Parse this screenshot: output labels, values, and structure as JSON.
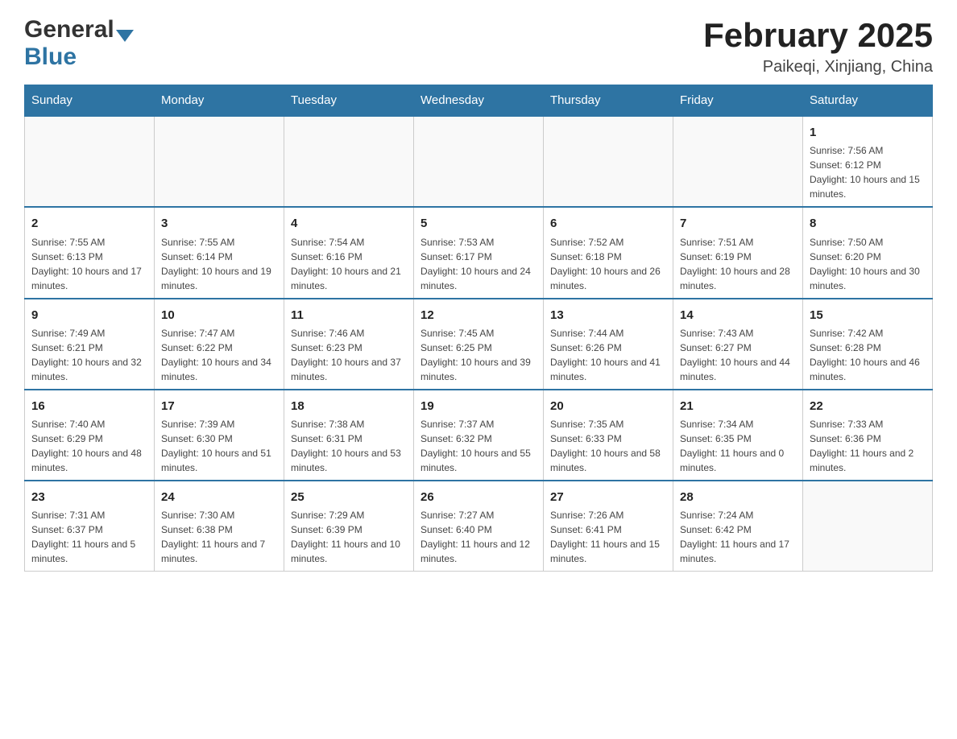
{
  "header": {
    "logo_general": "General",
    "logo_blue": "Blue",
    "month_title": "February 2025",
    "location": "Paikeqi, Xinjiang, China"
  },
  "weekdays": [
    "Sunday",
    "Monday",
    "Tuesday",
    "Wednesday",
    "Thursday",
    "Friday",
    "Saturday"
  ],
  "weeks": [
    [
      {
        "day": "",
        "info": ""
      },
      {
        "day": "",
        "info": ""
      },
      {
        "day": "",
        "info": ""
      },
      {
        "day": "",
        "info": ""
      },
      {
        "day": "",
        "info": ""
      },
      {
        "day": "",
        "info": ""
      },
      {
        "day": "1",
        "info": "Sunrise: 7:56 AM\nSunset: 6:12 PM\nDaylight: 10 hours and 15 minutes."
      }
    ],
    [
      {
        "day": "2",
        "info": "Sunrise: 7:55 AM\nSunset: 6:13 PM\nDaylight: 10 hours and 17 minutes."
      },
      {
        "day": "3",
        "info": "Sunrise: 7:55 AM\nSunset: 6:14 PM\nDaylight: 10 hours and 19 minutes."
      },
      {
        "day": "4",
        "info": "Sunrise: 7:54 AM\nSunset: 6:16 PM\nDaylight: 10 hours and 21 minutes."
      },
      {
        "day": "5",
        "info": "Sunrise: 7:53 AM\nSunset: 6:17 PM\nDaylight: 10 hours and 24 minutes."
      },
      {
        "day": "6",
        "info": "Sunrise: 7:52 AM\nSunset: 6:18 PM\nDaylight: 10 hours and 26 minutes."
      },
      {
        "day": "7",
        "info": "Sunrise: 7:51 AM\nSunset: 6:19 PM\nDaylight: 10 hours and 28 minutes."
      },
      {
        "day": "8",
        "info": "Sunrise: 7:50 AM\nSunset: 6:20 PM\nDaylight: 10 hours and 30 minutes."
      }
    ],
    [
      {
        "day": "9",
        "info": "Sunrise: 7:49 AM\nSunset: 6:21 PM\nDaylight: 10 hours and 32 minutes."
      },
      {
        "day": "10",
        "info": "Sunrise: 7:47 AM\nSunset: 6:22 PM\nDaylight: 10 hours and 34 minutes."
      },
      {
        "day": "11",
        "info": "Sunrise: 7:46 AM\nSunset: 6:23 PM\nDaylight: 10 hours and 37 minutes."
      },
      {
        "day": "12",
        "info": "Sunrise: 7:45 AM\nSunset: 6:25 PM\nDaylight: 10 hours and 39 minutes."
      },
      {
        "day": "13",
        "info": "Sunrise: 7:44 AM\nSunset: 6:26 PM\nDaylight: 10 hours and 41 minutes."
      },
      {
        "day": "14",
        "info": "Sunrise: 7:43 AM\nSunset: 6:27 PM\nDaylight: 10 hours and 44 minutes."
      },
      {
        "day": "15",
        "info": "Sunrise: 7:42 AM\nSunset: 6:28 PM\nDaylight: 10 hours and 46 minutes."
      }
    ],
    [
      {
        "day": "16",
        "info": "Sunrise: 7:40 AM\nSunset: 6:29 PM\nDaylight: 10 hours and 48 minutes."
      },
      {
        "day": "17",
        "info": "Sunrise: 7:39 AM\nSunset: 6:30 PM\nDaylight: 10 hours and 51 minutes."
      },
      {
        "day": "18",
        "info": "Sunrise: 7:38 AM\nSunset: 6:31 PM\nDaylight: 10 hours and 53 minutes."
      },
      {
        "day": "19",
        "info": "Sunrise: 7:37 AM\nSunset: 6:32 PM\nDaylight: 10 hours and 55 minutes."
      },
      {
        "day": "20",
        "info": "Sunrise: 7:35 AM\nSunset: 6:33 PM\nDaylight: 10 hours and 58 minutes."
      },
      {
        "day": "21",
        "info": "Sunrise: 7:34 AM\nSunset: 6:35 PM\nDaylight: 11 hours and 0 minutes."
      },
      {
        "day": "22",
        "info": "Sunrise: 7:33 AM\nSunset: 6:36 PM\nDaylight: 11 hours and 2 minutes."
      }
    ],
    [
      {
        "day": "23",
        "info": "Sunrise: 7:31 AM\nSunset: 6:37 PM\nDaylight: 11 hours and 5 minutes."
      },
      {
        "day": "24",
        "info": "Sunrise: 7:30 AM\nSunset: 6:38 PM\nDaylight: 11 hours and 7 minutes."
      },
      {
        "day": "25",
        "info": "Sunrise: 7:29 AM\nSunset: 6:39 PM\nDaylight: 11 hours and 10 minutes."
      },
      {
        "day": "26",
        "info": "Sunrise: 7:27 AM\nSunset: 6:40 PM\nDaylight: 11 hours and 12 minutes."
      },
      {
        "day": "27",
        "info": "Sunrise: 7:26 AM\nSunset: 6:41 PM\nDaylight: 11 hours and 15 minutes."
      },
      {
        "day": "28",
        "info": "Sunrise: 7:24 AM\nSunset: 6:42 PM\nDaylight: 11 hours and 17 minutes."
      },
      {
        "day": "",
        "info": ""
      }
    ]
  ]
}
